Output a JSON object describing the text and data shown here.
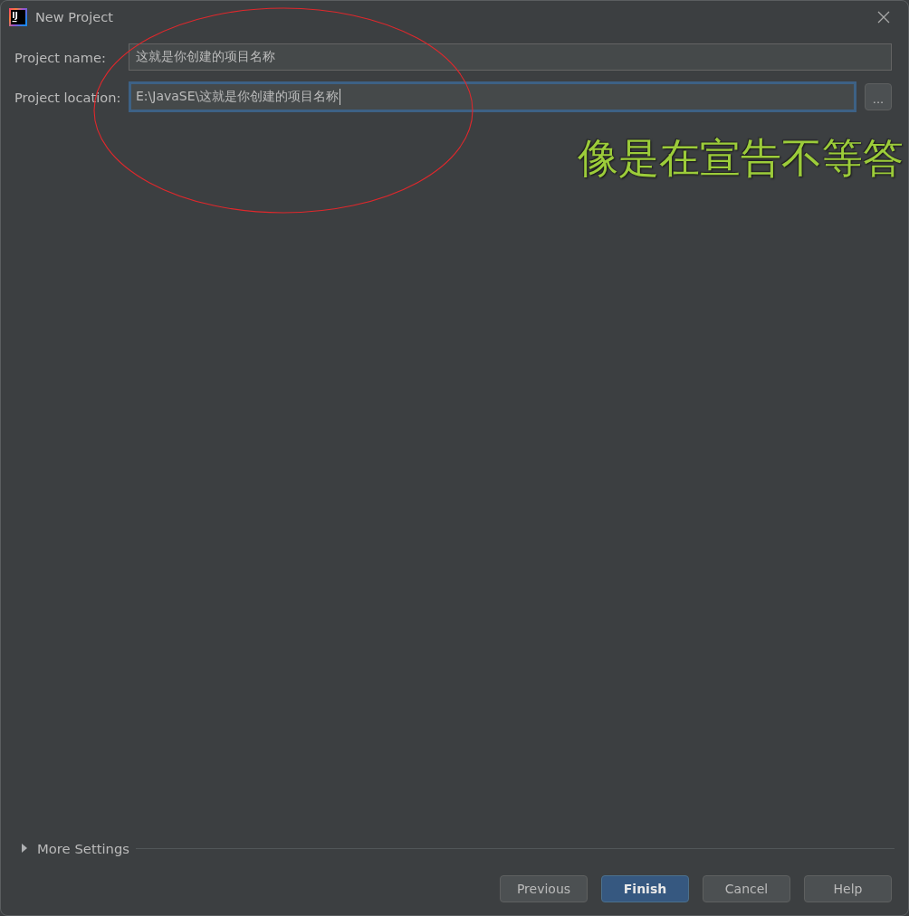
{
  "window": {
    "title": "New Project",
    "icon_text": "IJ"
  },
  "fields": [
    {
      "label": "Project name:",
      "value": "这就是你创建的项目名称",
      "focused": false
    },
    {
      "label": "Project location:",
      "value": "E:\\JavaSE\\这就是你创建的项目名称",
      "focused": true,
      "browse_button": "..."
    }
  ],
  "more_settings": {
    "label": "More Settings",
    "expanded": false
  },
  "buttons": [
    {
      "label": "Previous",
      "primary": false
    },
    {
      "label": "Finish",
      "primary": true
    },
    {
      "label": "Cancel",
      "primary": false
    },
    {
      "label": "Help",
      "primary": false
    }
  ],
  "annotations": [
    {
      "kind": "ellipse"
    },
    {
      "kind": "caption",
      "text": "像是在宣告不等答"
    }
  ]
}
